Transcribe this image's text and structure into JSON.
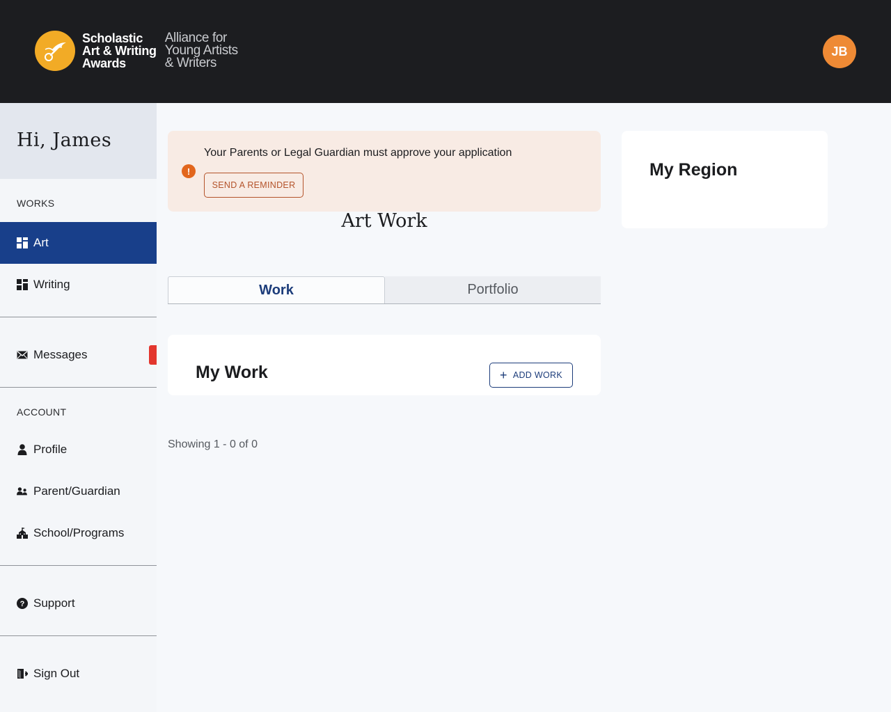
{
  "header": {
    "logo": {
      "line1": "Scholastic",
      "line2": "Art & Writing",
      "line3": "Awards",
      "sub1": "Alliance for",
      "sub2": "Young Artists",
      "sub3": "& Writers"
    },
    "avatar_initials": "JB"
  },
  "sidebar": {
    "greeting": "Hi, James",
    "works_label": "WORKS",
    "works": [
      {
        "label": "Art",
        "icon": "grid-icon",
        "active": true
      },
      {
        "label": "Writing",
        "icon": "grid-icon",
        "active": false
      }
    ],
    "messages": {
      "label": "Messages",
      "icon": "envelope-icon"
    },
    "account_label": "ACCOUNT",
    "account": [
      {
        "label": "Profile",
        "icon": "person-icon"
      },
      {
        "label": "Parent/Guardian",
        "icon": "people-icon"
      },
      {
        "label": "School/Programs",
        "icon": "school-icon"
      }
    ],
    "support": {
      "label": "Support",
      "icon": "question-icon"
    },
    "signout": {
      "label": "Sign Out",
      "icon": "sign-out-icon"
    }
  },
  "alert": {
    "message": "Your Parents or Legal Guardian must approve your application",
    "button": "SEND A REMINDER",
    "icon": "exclamation-icon"
  },
  "main": {
    "heading": "Art Work",
    "tabs": [
      {
        "label": "Work",
        "active": true
      },
      {
        "label": "Portfolio",
        "active": false
      }
    ],
    "work_card": {
      "title": "My Work",
      "add_button": "ADD WORK"
    },
    "showing": "Showing 1 - 0 of 0"
  },
  "region": {
    "title": "My Region"
  },
  "colors": {
    "header_bg": "#1c1d20",
    "active_nav": "#183f8a",
    "avatar": "#ee8a35",
    "alert_bg": "#f8ebe4",
    "alert_accent": "#b4532a",
    "badge": "#e3362e",
    "brand_blue": "#1c3c7a",
    "logo_gold": "#f2ab26"
  }
}
